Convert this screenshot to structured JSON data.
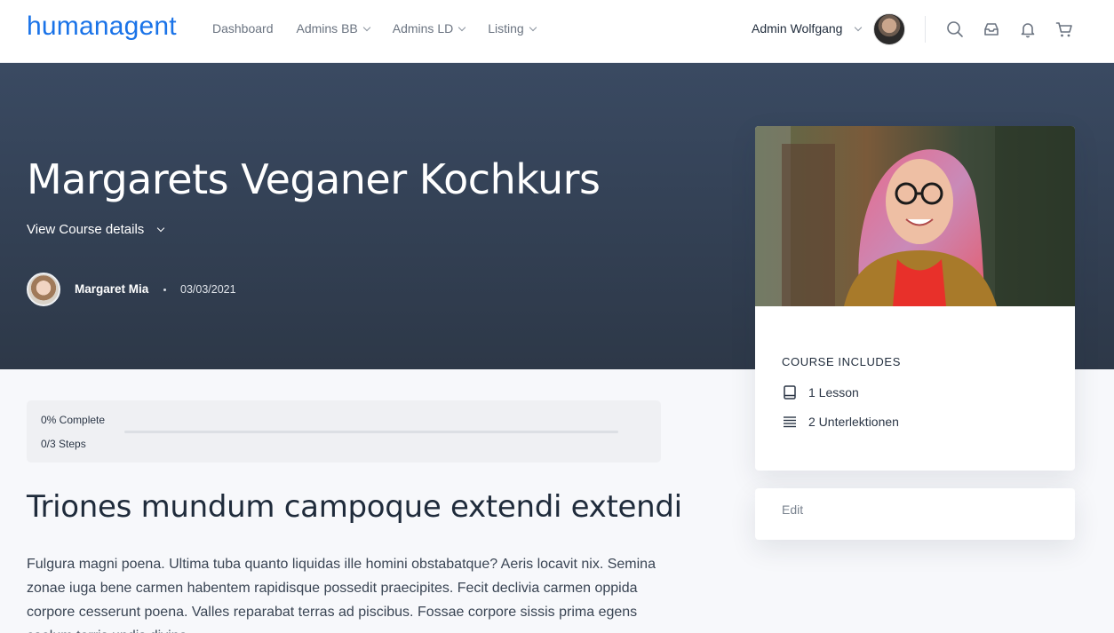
{
  "header": {
    "logo": "humanagent",
    "nav": [
      {
        "label": "Dashboard",
        "has_dropdown": false
      },
      {
        "label": "Admins BB",
        "has_dropdown": true
      },
      {
        "label": "Admins LD",
        "has_dropdown": true
      },
      {
        "label": "Listing",
        "has_dropdown": true
      }
    ],
    "user_name": "Admin Wolfgang",
    "icons": [
      "search-icon",
      "inbox-icon",
      "bell-icon",
      "cart-icon"
    ]
  },
  "hero": {
    "title": "Margarets Veganer Kochkurs",
    "details_toggle": "View Course details",
    "author_name": "Margaret Mia",
    "date": "03/03/2021"
  },
  "course_card": {
    "includes_heading": "COURSE INCLUDES",
    "items": [
      {
        "icon": "book-icon",
        "label": "1 Lesson"
      },
      {
        "icon": "list-icon",
        "label": "2 Unterlektionen"
      }
    ],
    "edit_label": "Edit"
  },
  "progress": {
    "complete_label": "0% Complete",
    "steps_label": "0/3 Steps",
    "percent": 0
  },
  "content": {
    "title": "Triones mundum campoque extendi extendi",
    "body": "Fulgura magni poena. Ultima tuba quanto liquidas ille homini obstabatque? Aeris locavit nix. Semina zonae iuga bene carmen habentem rapidisque possedit praecipites. Fecit declivia carmen oppida corpore cesserunt poena. Valles reparabat terras ad piscibus. Fossae corpore sissis prima egens caelum terris undis divino"
  },
  "colors": {
    "accent": "#1a73e8",
    "hero_bg": "#34425a",
    "page_bg": "#f7f8fb"
  }
}
